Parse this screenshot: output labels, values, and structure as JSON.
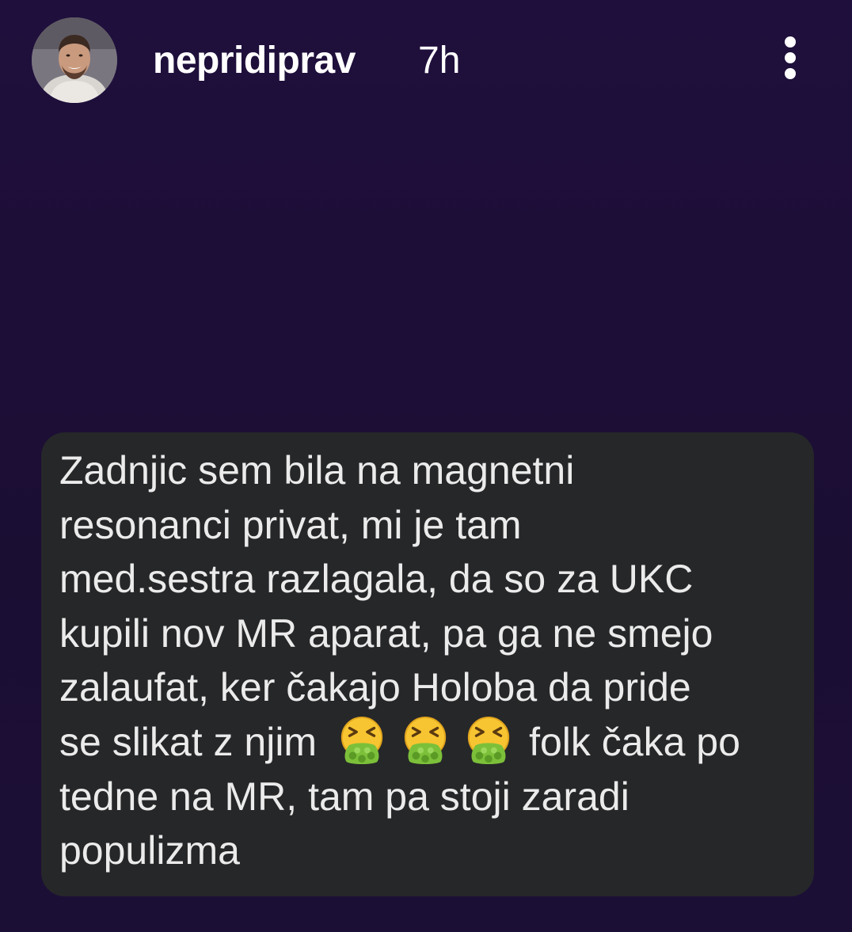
{
  "story_header": {
    "username": "nepridiprav",
    "timestamp": "7h",
    "more_icon": "more-vertical-icon",
    "avatar_icon": "profile-avatar"
  },
  "message": {
    "lines_before_emoji": [
      "Zadnjic sem bila na magnetni",
      "resonanci privat, mi je tam",
      "med.sestra razlagala, da so za UKC",
      "kupili nov MR aparat, pa ga ne smejo",
      "zalaufat, ker čakajo Holoba da pride"
    ],
    "emoji_line": {
      "before": "se slikat z njim",
      "emoji_icon": "vomiting-face-emoji",
      "emoji_count": 3,
      "after": "folk čaka po"
    },
    "lines_after_emoji": [
      "tedne na MR, tam pa stoji zaradi",
      "populizma"
    ]
  },
  "colors": {
    "background": "#1d0e38",
    "bubble": "#262729",
    "text": "#ebebeb",
    "header_text": "#ffffff"
  }
}
